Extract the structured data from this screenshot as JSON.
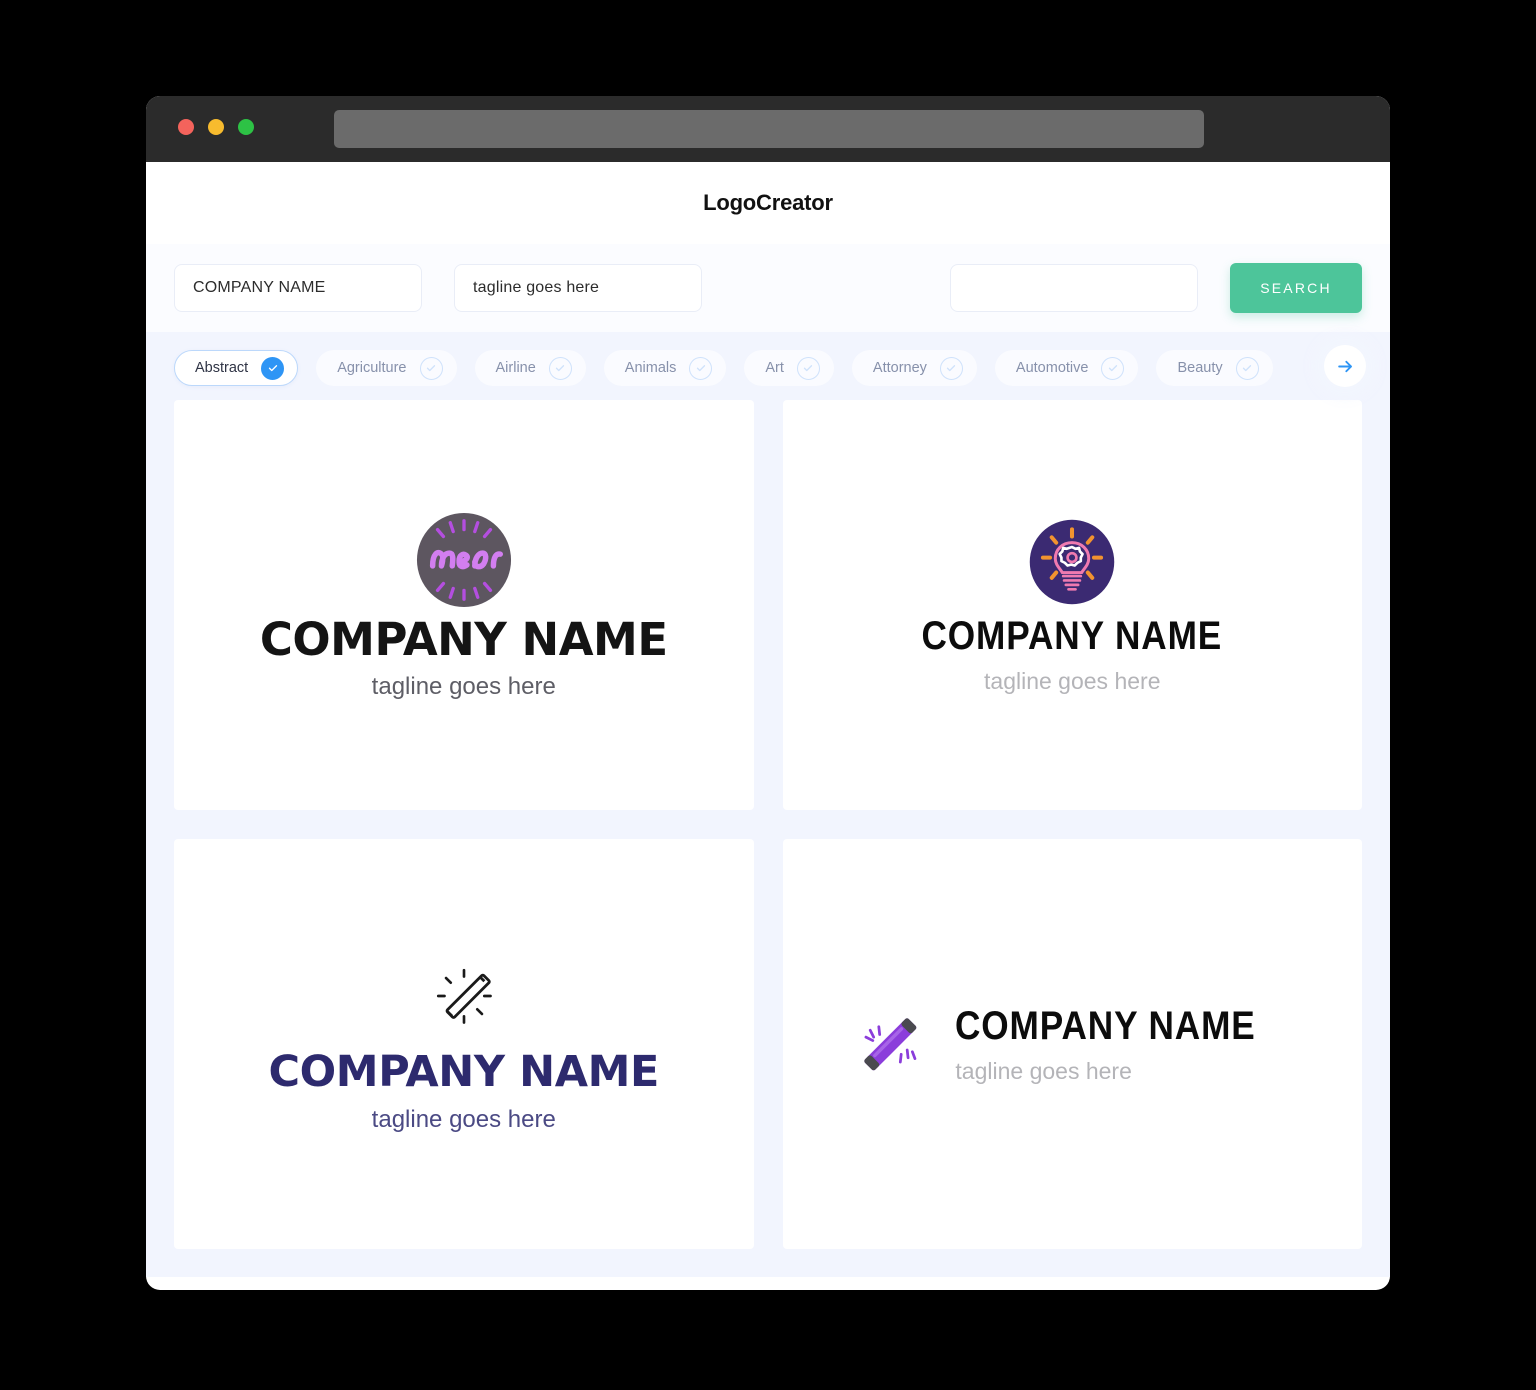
{
  "window": {
    "traffic_lights": [
      {
        "name": "close",
        "color": "#f4635c"
      },
      {
        "name": "minimize",
        "color": "#f7bb2e"
      },
      {
        "name": "maximize",
        "color": "#2dc245"
      }
    ],
    "url_value": ""
  },
  "header": {
    "title": "LogoCreator"
  },
  "search": {
    "company_value": "COMPANY NAME",
    "company_placeholder": "COMPANY NAME",
    "tagline_value": "tagline goes here",
    "tagline_placeholder": "tagline goes here",
    "extra_value": "",
    "extra_placeholder": "",
    "button_label": "SEARCH",
    "button_color": "#4dc59a"
  },
  "categories": {
    "active_index": 0,
    "next_icon": "arrow-right-icon",
    "items": [
      {
        "label": "Abstract",
        "selected": true
      },
      {
        "label": "Agriculture",
        "selected": false
      },
      {
        "label": "Airline",
        "selected": false
      },
      {
        "label": "Animals",
        "selected": false
      },
      {
        "label": "Art",
        "selected": false
      },
      {
        "label": "Attorney",
        "selected": false
      },
      {
        "label": "Automotive",
        "selected": false
      },
      {
        "label": "Beauty",
        "selected": false
      }
    ]
  },
  "results": [
    {
      "id": "logo-neon-badge",
      "icon": "neon-circle-badge-icon",
      "company_name": "COMPANY NAME",
      "tagline": "tagline goes here",
      "name_color": "#141414",
      "tagline_color": "#5e5e66",
      "accent_color": "#b44ee0",
      "badge_color": "#5d5660"
    },
    {
      "id": "logo-lightbulb-gear",
      "icon": "lightbulb-gear-circle-icon",
      "company_name": "COMPANY NAME",
      "tagline": "tagline goes here",
      "name_color": "#0c0c0c",
      "tagline_color": "#b4b4b8",
      "accent_color": "#f07ab0",
      "badge_color": "#3b2a72"
    },
    {
      "id": "logo-neon-tube-outline",
      "icon": "neon-tube-outline-icon",
      "company_name": "COMPANY NAME",
      "tagline": "tagline goes here",
      "name_color": "#2d2a6e",
      "tagline_color": "#4b4a84",
      "accent_color": "#1a1a1a"
    },
    {
      "id": "logo-neon-tube-purple",
      "icon": "neon-tube-purple-icon",
      "company_name": "COMPANY NAME",
      "tagline": "tagline goes here",
      "name_color": "#0c0c0c",
      "tagline_color": "#b4b4b8",
      "accent_color": "#8b3ddb"
    }
  ]
}
